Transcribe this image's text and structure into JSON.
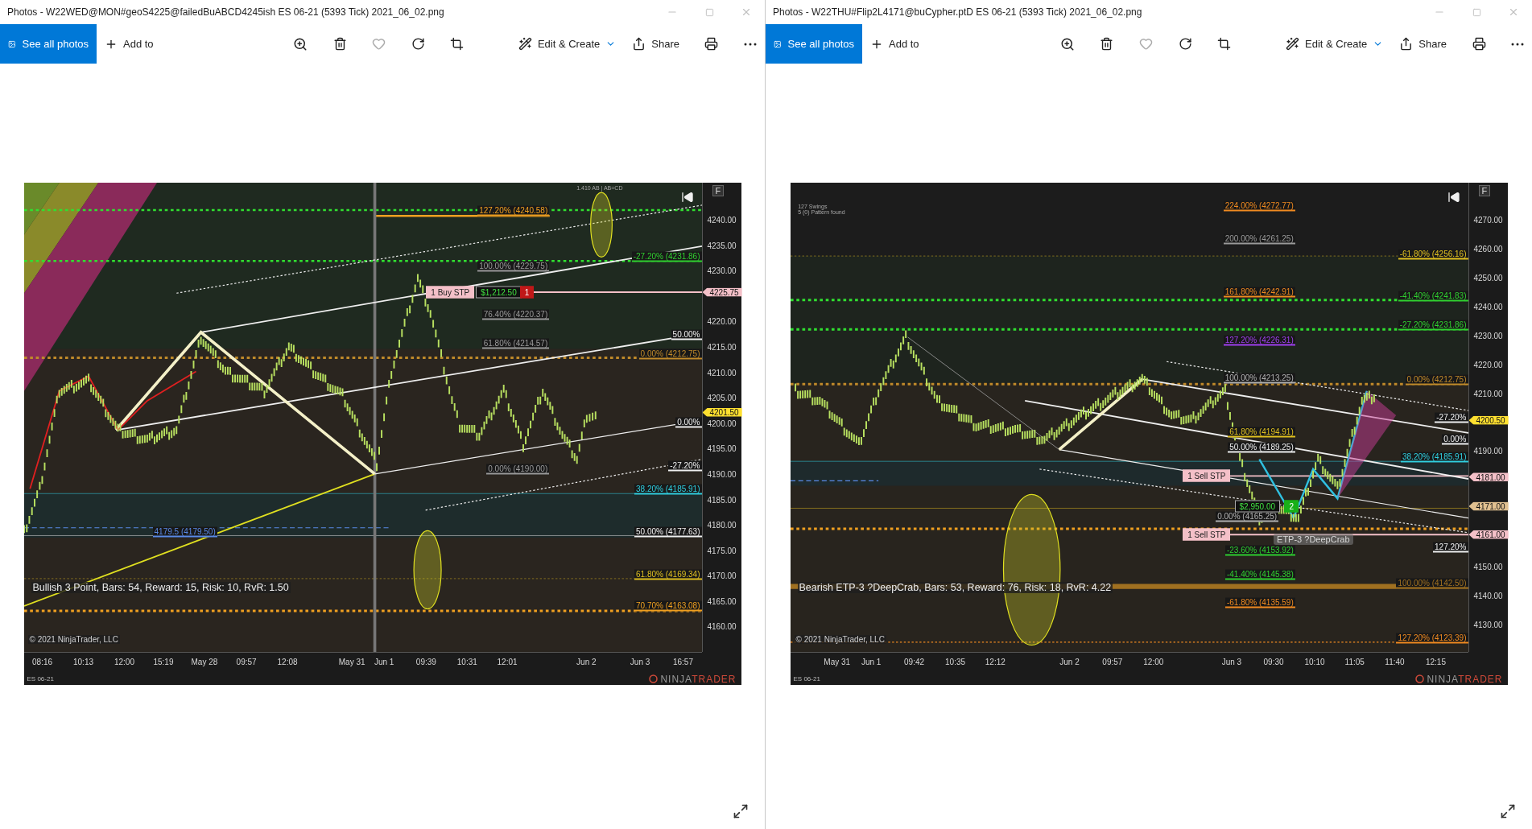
{
  "windows": [
    {
      "title": "Photos - W22WED@MON#geoS4225@failedBuABCD4245ish ES 06-21 (5393 Tick) 2021_06_02.png",
      "toolbar": {
        "see_all": "See all photos",
        "add_to": "Add to",
        "edit_create": "Edit & Create",
        "share": "Share"
      },
      "chart": {
        "y_axis": [
          "4240.00",
          "4235.00",
          "4230.00",
          "4220.00",
          "4215.00",
          "4210.00",
          "4205.00",
          "4200.00",
          "4195.00",
          "4190.00",
          "4185.00",
          "4180.00",
          "4175.00",
          "4170.00",
          "4165.00",
          "4160.00"
        ],
        "time_axis": [
          "08:16",
          "10:13",
          "12:00",
          "15:19",
          "May 28",
          "09:57",
          "12:08",
          "May 31",
          "Jun 1",
          "09:39",
          "10:31",
          "12:01",
          "Jun 2",
          "Jun 3",
          "16:57"
        ],
        "levels": [
          {
            "text": "127.20% (4240.58)",
            "color": "#f0a020"
          },
          {
            "text": "-27.20% (4231.86)",
            "color": "#30d030"
          },
          {
            "text": "100.00% (4229.75)",
            "color": "#9a9a9a"
          },
          {
            "text": "76.40% (4220.37)",
            "color": "#9a9a9a"
          },
          {
            "text": "61.80% (4214.57)",
            "color": "#9a9a9a"
          },
          {
            "text": "50.00%",
            "color": "#f0f0f0"
          },
          {
            "text": "0.00% (4212.75)",
            "color": "#c08a2a"
          },
          {
            "text": "0.00%",
            "color": "#f0f0f0"
          },
          {
            "text": "-27.20%",
            "color": "#f0f0f0"
          },
          {
            "text": "0.00% (4190.00)",
            "color": "#9a9a9a"
          },
          {
            "text": "38.20% (4185.91)",
            "color": "#30d0e0"
          },
          {
            "text": "4179.5 (4179.50)",
            "color": "#5a8ae6"
          },
          {
            "text": "50.00% (4177.63)",
            "color": "#f0f0f0"
          },
          {
            "text": "61.80% (4169.34)",
            "color": "#e0c020"
          },
          {
            "text": "70.70% (4163.08)",
            "color": "#f0a020"
          }
        ],
        "notes": [
          {
            "text": "1.410 AB | AB=CD"
          }
        ],
        "price_tags": [
          {
            "text": "4225.75",
            "color": "#f4c0c8"
          },
          {
            "text": "4201.50",
            "color": "#ffe030"
          }
        ],
        "order_tags": [
          {
            "text": "1  Buy STP",
            "kind": "order",
            "color": "#f4c0c8"
          },
          {
            "text": "$1,212.50",
            "kind": "pnl",
            "color": "#101010"
          },
          {
            "text": "1",
            "kind": "count",
            "color": "#c01818"
          }
        ],
        "headline": "Bullish 3 Point, Bars: 54, Reward: 15, Risk: 10, RvR: 1.50",
        "copyright": "© 2021 NinjaTrader, LLC",
        "symbol": "ES 06-21",
        "logo_a": "NINJA",
        "logo_b": "TRADER",
        "f_button": "F"
      }
    },
    {
      "title": "Photos - W22THU#Flip2L4171@buCypher.ptD ES 06-21 (5393 Tick) 2021_06_02.png",
      "toolbar": {
        "see_all": "See all photos",
        "add_to": "Add to",
        "edit_create": "Edit & Create",
        "share": "Share"
      },
      "chart": {
        "y_axis": [
          "4270.00",
          "4260.00",
          "4250.00",
          "4240.00",
          "4230.00",
          "4220.00",
          "4210.00",
          "4190.00",
          "4150.00",
          "4140.00",
          "4130.00"
        ],
        "time_axis": [
          "May 31",
          "Jun 1",
          "09:42",
          "10:35",
          "12:12",
          "Jun 2",
          "09:57",
          "12:00",
          "Jun 3",
          "09:30",
          "10:10",
          "11:05",
          "11:40",
          "12:15"
        ],
        "levels": [
          {
            "text": "224.00% (4272.77)",
            "color": "#f08a20"
          },
          {
            "text": "200.00% (4261.25)",
            "color": "#9a9a9a"
          },
          {
            "text": "-61.80% (4256.16)",
            "color": "#e0c020"
          },
          {
            "text": "161.80% (4242.91)",
            "color": "#f08a20"
          },
          {
            "text": "-41.40% (4241.83)",
            "color": "#30d030"
          },
          {
            "text": "-27.20% (4231.86)",
            "color": "#30d030"
          },
          {
            "text": "127.20% (4226.31)",
            "color": "#a040f0"
          },
          {
            "text": "100.00% (4213.25)",
            "color": "#b0b0b0"
          },
          {
            "text": "0.00% (4212.75)",
            "color": "#c08a2a"
          },
          {
            "text": "-27.20%",
            "color": "#f0f0f0"
          },
          {
            "text": "61.80% (4194.91)",
            "color": "#e0c020"
          },
          {
            "text": "0.00%",
            "color": "#f0f0f0"
          },
          {
            "text": "50.00% (4189.25)",
            "color": "#f0f0f0"
          },
          {
            "text": "38.20% (4185.91)",
            "color": "#30d0e0"
          },
          {
            "text": "0.00% (4165.25)",
            "color": "#b0b0b0"
          },
          {
            "text": "127.20%",
            "color": "#f0f0f0"
          },
          {
            "text": "-23.60% (4153.92)",
            "color": "#30d030"
          },
          {
            "text": "-41.40% (4145.38)",
            "color": "#30d030"
          },
          {
            "text": "100.00% (4142.50)",
            "color": "#a07020"
          },
          {
            "text": "-61.80% (4135.59)",
            "color": "#f08a20"
          },
          {
            "text": "127.20% (4123.39)",
            "color": "#f08a20"
          }
        ],
        "notes": [
          {
            "text": "127 Swings"
          },
          {
            "text": "5 (0) Pattern found"
          },
          {
            "text": "ETP-3 ?DeepCrab"
          }
        ],
        "price_tags": [
          {
            "text": "4200.50",
            "color": "#ffe030"
          },
          {
            "text": "4181.00",
            "color": "#f4c0c8"
          },
          {
            "text": "4171.00",
            "color": "#e0c090"
          },
          {
            "text": "4161.00",
            "color": "#f4c0c8"
          }
        ],
        "order_tags": [
          {
            "text": "1  Sell STP",
            "kind": "order",
            "color": "#f4c0c8"
          },
          {
            "text": "1  Sell STP",
            "kind": "order",
            "color": "#f4c0c8"
          },
          {
            "text": "$2,950.00",
            "kind": "pnl",
            "color": "#101010"
          },
          {
            "text": "2",
            "kind": "count",
            "color": "#18b018"
          }
        ],
        "headline": "Bearish ETP-3 ?DeepCrab, Bars: 53, Reward: 76, Risk: 18, RvR: 4.22",
        "copyright": "© 2021 NinjaTrader, LLC",
        "symbol": "ES 06-21",
        "logo_a": "NINJA",
        "logo_b": "TRADER",
        "f_button": "F"
      }
    }
  ]
}
